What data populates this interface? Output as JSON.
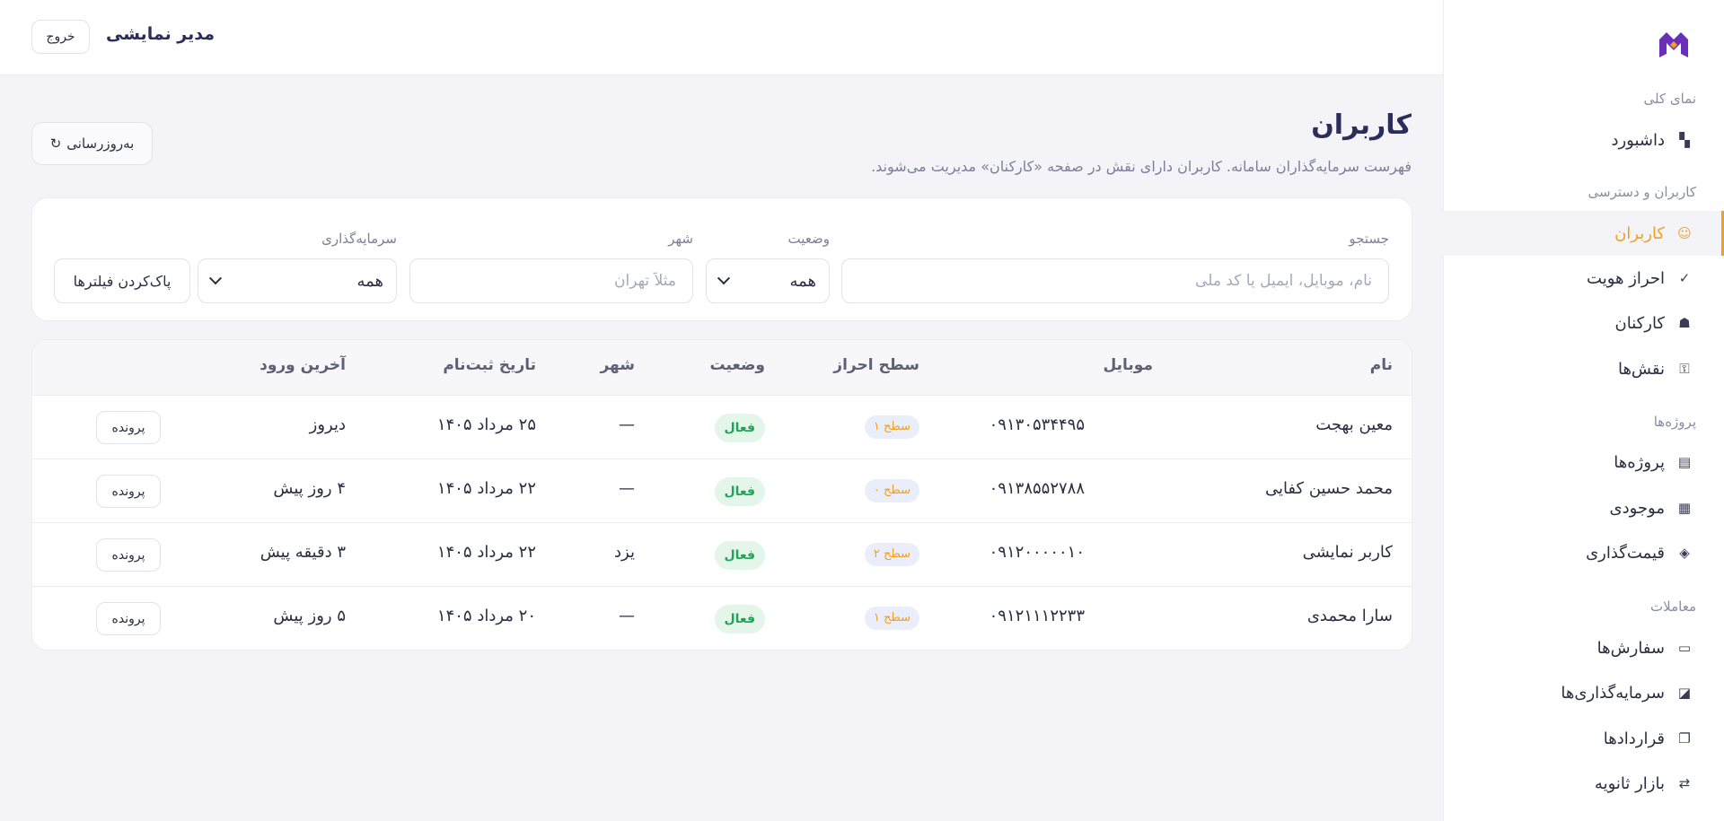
{
  "topbar": {
    "title": "مدیر نمایشی",
    "logout_label": "خروج"
  },
  "sidebar": {
    "logo_icon": "logo-icon",
    "sections": [
      {
        "title": "نمای کلی"
      },
      {
        "title": "کاربران و دسترسی"
      },
      {
        "title": "پروژه‌ها"
      },
      {
        "title": "معاملات"
      }
    ],
    "items": [
      {
        "label": "داشبورد",
        "icon": "▚"
      },
      {
        "label": "کاربران",
        "icon": "☺"
      },
      {
        "label": "احراز هویت",
        "icon": "✓"
      },
      {
        "label": "کارکنان",
        "icon": "☗"
      },
      {
        "label": "نقش‌ها",
        "icon": "⚿"
      },
      {
        "label": "پروژه‌ها",
        "icon": "▤"
      },
      {
        "label": "موجودی",
        "icon": "▦"
      },
      {
        "label": "قیمت‌گذاری",
        "icon": "◈"
      },
      {
        "label": "سفارش‌ها",
        "icon": "▭"
      },
      {
        "label": "سرمایه‌گذاری‌ها",
        "icon": "◪"
      },
      {
        "label": "قراردادها",
        "icon": "❐"
      },
      {
        "label": "بازار ثانویه",
        "icon": "⇄"
      }
    ],
    "active_color": "#f0a020"
  },
  "page": {
    "title": "کاربران",
    "subtitle": "فهرست سرمایه‌گذاران سامانه. کاربران دارای نقش در صفحه «کارکنان» مدیریت می‌شوند.",
    "refresh_label": "به‌روزرسانی",
    "refresh_icon": "↻"
  },
  "filters": {
    "search_label": "جستجو",
    "search_placeholder": "نام، موبایل، ایمیل یا کد ملی",
    "status_label": "وضعیت",
    "status_value": "همه",
    "city_label": "شهر",
    "city_placeholder": "مثلاً تهران",
    "investment_label": "سرمایه‌گذاری",
    "investment_value": "همه",
    "clear_label": "پاک‌کردن فیلترها"
  },
  "table": {
    "headers": {
      "name": "نام",
      "mobile": "موبایل",
      "level": "سطح احراز",
      "status": "وضعیت",
      "city": "شهر",
      "registered": "تاریخ ثبت‌نام",
      "last_login": "آخرین ورود"
    },
    "rows": [
      {
        "name": "معین بهجت",
        "mobile": "۰۹۱۳۰۵۳۴۴۹۵",
        "level": "سطح ۱",
        "status": "فعال",
        "city": "—",
        "registered": "۲۵ مرداد ۱۴۰۵",
        "last_login": "دیروز",
        "action": "پرونده"
      },
      {
        "name": "محمد حسین کفایی",
        "mobile": "۰۹۱۳۸۵۵۲۷۸۸",
        "level": "سطح ۰",
        "status": "فعال",
        "city": "—",
        "registered": "۲۲ مرداد ۱۴۰۵",
        "last_login": "۴ روز پیش",
        "action": "پرونده"
      },
      {
        "name": "کاربر نمایشی",
        "mobile": "۰۹۱۲۰۰۰۰۰۱۰",
        "level": "سطح ۲",
        "status": "فعال",
        "city": "یزد",
        "registered": "۲۲ مرداد ۱۴۰۵",
        "last_login": "۳ دقیقه پیش",
        "action": "پرونده"
      },
      {
        "name": "سارا محمدی",
        "mobile": "۰۹۱۲۱۱۱۲۲۳۳",
        "level": "سطح ۱",
        "status": "فعال",
        "city": "—",
        "registered": "۲۰ مرداد ۱۴۰۵",
        "last_login": "۵ روز پیش",
        "action": "پرونده"
      }
    ]
  }
}
